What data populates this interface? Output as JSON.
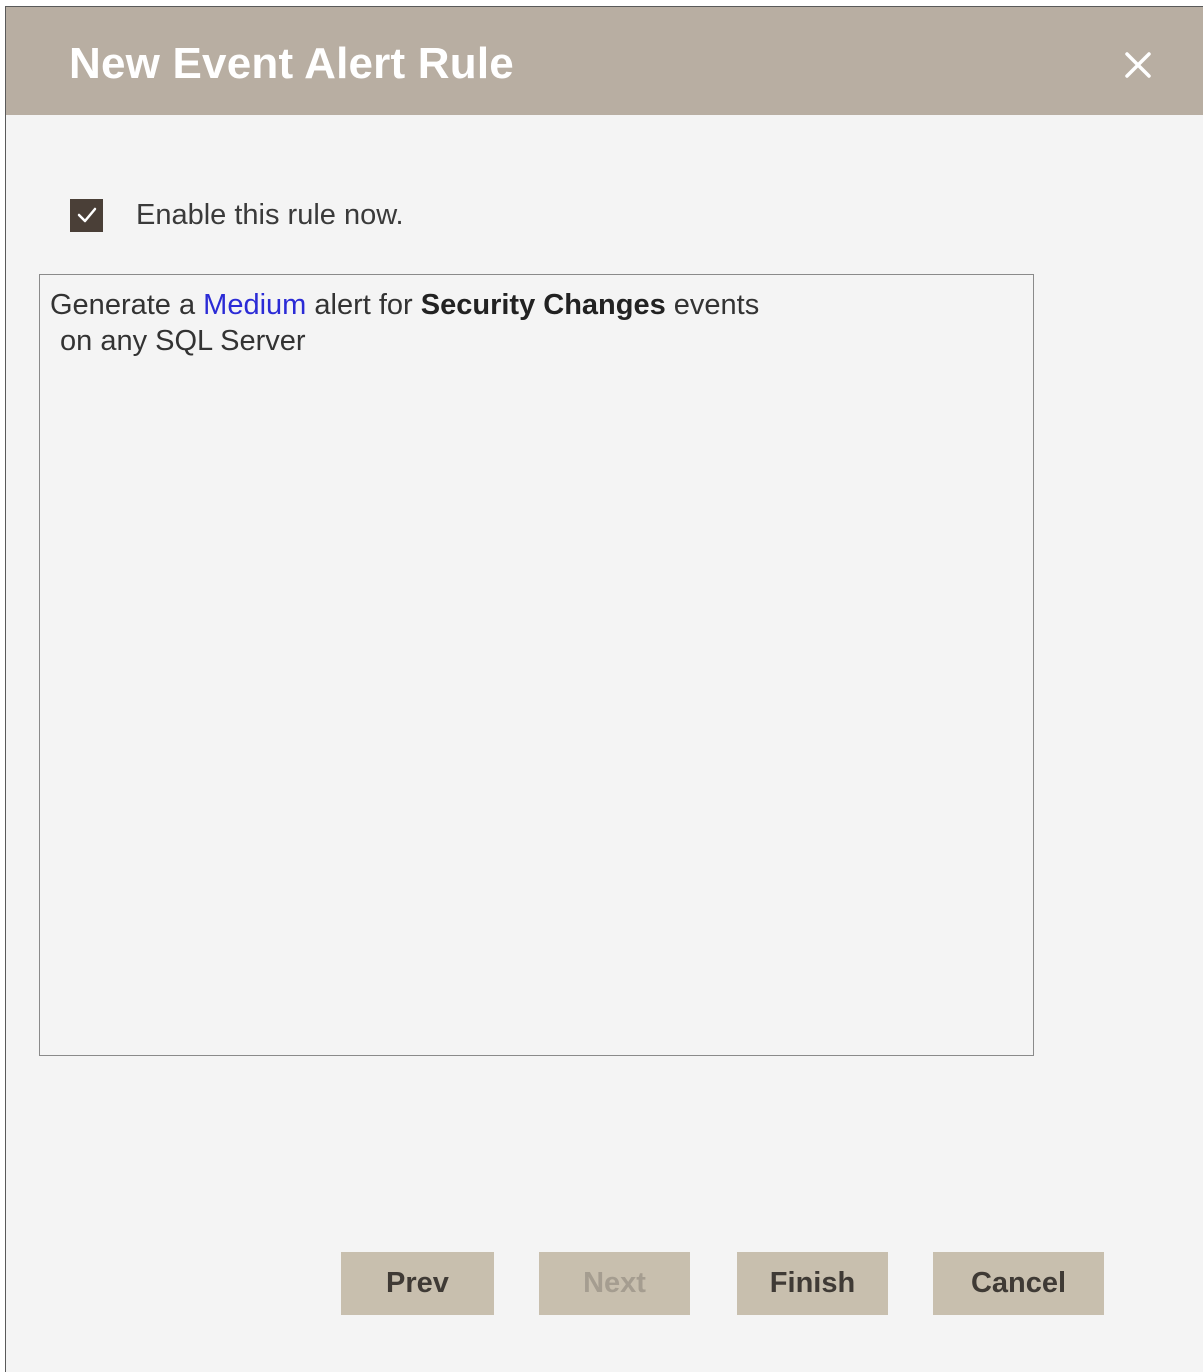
{
  "dialog": {
    "title": "New Event Alert Rule",
    "close_icon": "close-icon"
  },
  "enable": {
    "checked": true,
    "label": "Enable this rule now."
  },
  "summary": {
    "line1_prefix": "Generate a ",
    "severity_link": "Medium",
    "line1_mid": " alert for ",
    "event_type": "Security Changes",
    "line1_suffix": " events",
    "line2": "on any SQL Server"
  },
  "buttons": {
    "prev": "Prev",
    "next": "Next",
    "finish": "Finish",
    "cancel": "Cancel"
  },
  "colors": {
    "titlebar": "#b8aea2",
    "button": "#c8bfae",
    "link": "#2b2bd6",
    "checkbox": "#4a3f37"
  }
}
